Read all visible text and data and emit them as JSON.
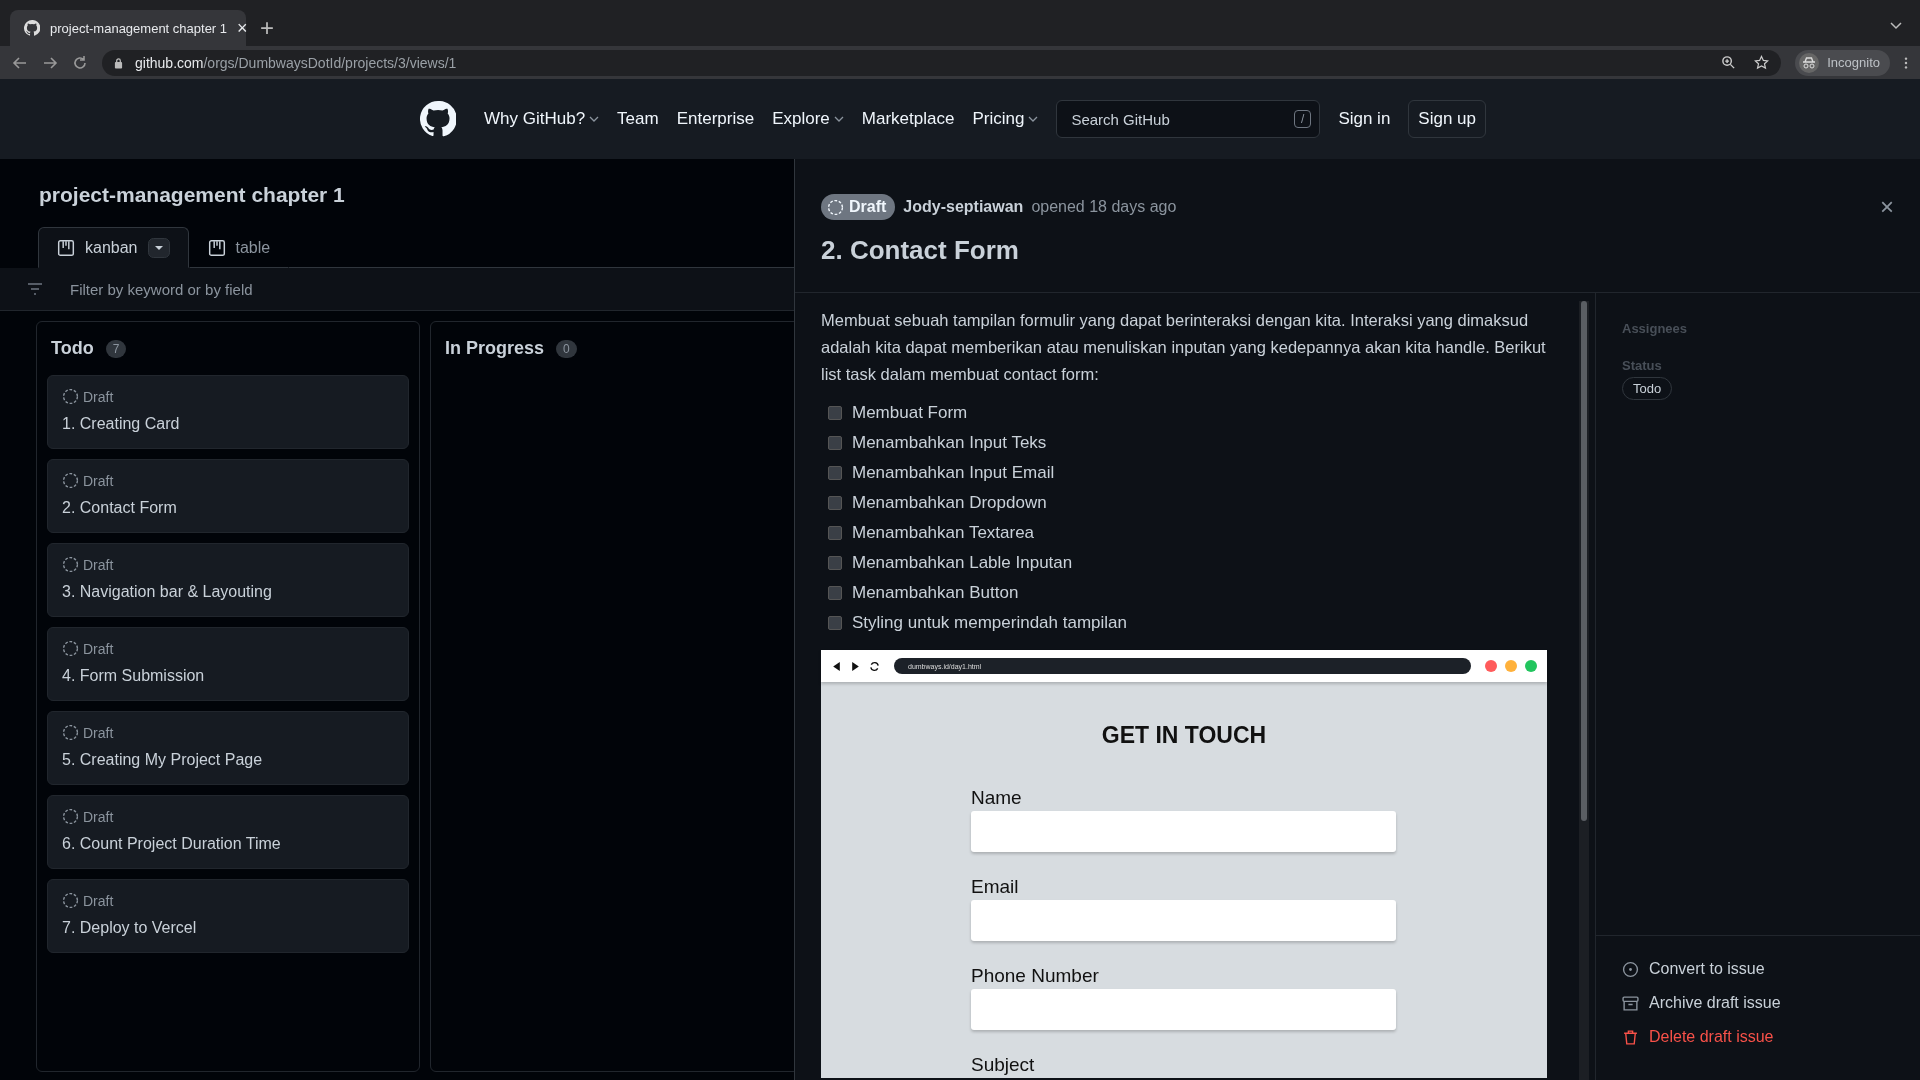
{
  "browser": {
    "tab_title": "project-management chapter 1",
    "tab_close": "×",
    "new_tab": "+",
    "url_host": "github.com",
    "url_path": "/orgs/DumbwaysDotId/projects/3/views/1",
    "incognito": "Incognito"
  },
  "nav": {
    "items": [
      {
        "label": "Why GitHub?",
        "dropdown": true
      },
      {
        "label": "Team",
        "dropdown": false
      },
      {
        "label": "Enterprise",
        "dropdown": false
      },
      {
        "label": "Explore",
        "dropdown": true
      },
      {
        "label": "Marketplace",
        "dropdown": false
      },
      {
        "label": "Pricing",
        "dropdown": true
      }
    ],
    "search_placeholder": "Search GitHub",
    "search_key": "/",
    "sign_in": "Sign in",
    "sign_up": "Sign up"
  },
  "project": {
    "title": "project-management chapter 1",
    "views": [
      {
        "label": "kanban",
        "selected": true,
        "dropdown": true
      },
      {
        "label": "table",
        "selected": false,
        "dropdown": false
      }
    ],
    "filter_placeholder": "Filter by keyword or by field",
    "columns": [
      {
        "name": "Todo",
        "count": "7",
        "cards": [
          {
            "status": "Draft",
            "title": "1. Creating Card"
          },
          {
            "status": "Draft",
            "title": "2. Contact Form"
          },
          {
            "status": "Draft",
            "title": "3. Navigation bar & Layouting"
          },
          {
            "status": "Draft",
            "title": "4. Form Submission"
          },
          {
            "status": "Draft",
            "title": "5. Creating My Project Page"
          },
          {
            "status": "Draft",
            "title": "6. Count Project Duration Time"
          },
          {
            "status": "Draft",
            "title": "7. Deploy to Vercel"
          }
        ]
      },
      {
        "name": "In Progress",
        "count": "0"
      }
    ]
  },
  "detail": {
    "badge": "Draft",
    "author": "Jody-septiawan",
    "meta": "opened 18 days ago",
    "title": "2. Contact Form",
    "close": "×",
    "description": "Membuat sebuah tampilan formulir yang dapat berinteraksi dengan kita. Interaksi yang dimaksud adalah kita dapat memberikan atau menuliskan inputan yang kedepannya akan kita handle. Berikut list task dalam membuat contact form:",
    "tasks": [
      {
        "label": "Membuat Form",
        "checked": false
      },
      {
        "label": "Menambahkan Input Teks",
        "checked": false
      },
      {
        "label": "Menambahkan Input Email",
        "checked": false
      },
      {
        "label": "Menambahkan Dropdown",
        "checked": false
      },
      {
        "label": "Menambahkan Textarea",
        "checked": false
      },
      {
        "label": "Menambahkan Lable Inputan",
        "checked": false
      },
      {
        "label": "Menambahkan Button",
        "checked": false
      },
      {
        "label": "Styling untuk memperindah tampilan",
        "checked": false
      }
    ],
    "image": {
      "url": "dumbways.id/day1.html",
      "heading": "GET IN TOUCH",
      "fields": [
        "Name",
        "Email",
        "Phone Number",
        "Subject"
      ]
    },
    "sidebar": {
      "assignees_label": "Assignees",
      "status_label": "Status",
      "status_value": "Todo"
    },
    "actions": [
      {
        "label": "Convert to issue",
        "kind": "convert"
      },
      {
        "label": "Archive draft issue",
        "kind": "archive"
      },
      {
        "label": "Delete draft issue",
        "kind": "delete"
      }
    ]
  }
}
